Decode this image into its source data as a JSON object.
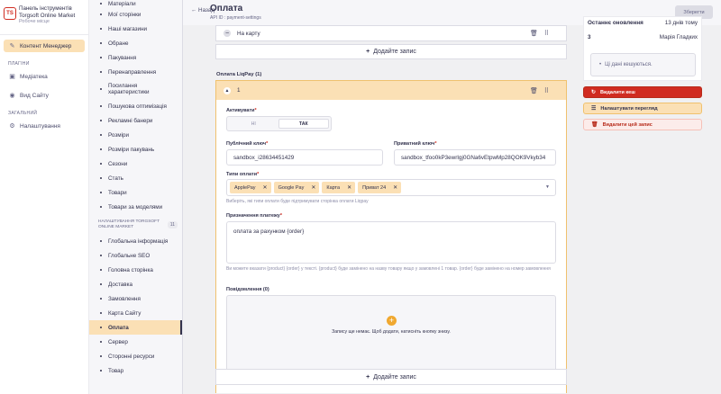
{
  "brand": {
    "title_line1": "Панель інструментів",
    "title_line2": "Torgsoft Online Market",
    "subtitle": "Робоче місце",
    "logo": "TS"
  },
  "leftnav": {
    "active_label": "Контент Менеджер",
    "plugins_section": "ПЛАГІНИ",
    "plugins": [
      {
        "icon": "image-icon",
        "label": "Медіатека"
      },
      {
        "icon": "eye-icon",
        "label": "Вид Сайту"
      }
    ],
    "general_section": "ЗАГАЛЬНИЙ",
    "general": [
      {
        "icon": "gear-icon",
        "label": "Налаштування"
      }
    ]
  },
  "subnav": {
    "items_top": [
      "Матеріали",
      "Мої сторінки",
      "Наші магазини",
      "Обране",
      "Пакування",
      "Перенаправлення",
      "Посилання характеристики",
      "Пошукова оптимізація",
      "Рекламні банери",
      "Розміри",
      "Розміри пакувань",
      "Сезони",
      "Стать",
      "Товари",
      "Товари за моделями"
    ],
    "section_label": "НАЛАШТУВАННЯ TORGSOFT ONLINE MARKET",
    "section_count": "11",
    "items_settings": [
      "Глобальна інформація",
      "Глобальне SEO",
      "Головна сторінка",
      "Доставка",
      "Замовлення",
      "Карта Сайту",
      "Оплата",
      "Сервер",
      "Сторонні ресурси",
      "Товар"
    ],
    "active_item": "Оплата"
  },
  "header": {
    "back_label": "Назад",
    "title": "Оплата",
    "api_id": "API ID : payment-settings",
    "save_label": "Зберегти"
  },
  "content": {
    "collapsed_row_title": "На карту",
    "add_label": "Додайте запис",
    "group_label": "Оплата LiqPay (1)",
    "expanded_title": "1",
    "active_label": "Активувати",
    "toggle_off": "НІ",
    "toggle_on": "ТАК",
    "public_key_label": "Публічний ключ",
    "public_key_value": "sandbox_i28634451429",
    "private_key_label": "Приватний ключ",
    "private_key_value": "sandbox_tfoo0kP3ewrIgj0GNa6vEtpwMp28QOK9Vkyb34",
    "payment_types_label": "Типи оплати",
    "payment_types": [
      "ApplePay",
      "Google Pay",
      "Карта",
      "Приват 24"
    ],
    "payment_types_hint": "Виберіть, які типи оплати буде підтримувати сторінка оплати Liqpay",
    "purpose_label": "Призначення платежу",
    "purpose_value": "оплата за рахунком {order}",
    "purpose_hint": "Ви можете вказати {product} {order} у тексті. {product} буде замінено на назву товару якщо у замовлені 1 товар. {order} буде замінено на номер замовлення",
    "messages_label": "Повідомлення (0)",
    "empty_text": "Запису ще немає. Щоб додати, натисніть кнопку знизу."
  },
  "rightpanel": {
    "last_update_label": "Останнє оновлення",
    "last_update_value": "13 днів тому",
    "by_label": "3",
    "by_value": "Марія Гладких",
    "cache_text": "Ці дані кешуються.",
    "btn_delete_cache": "Видалити кеш",
    "btn_setup_preview": "Налаштувати перегляд",
    "btn_delete_record": "Видалити цей запис"
  }
}
